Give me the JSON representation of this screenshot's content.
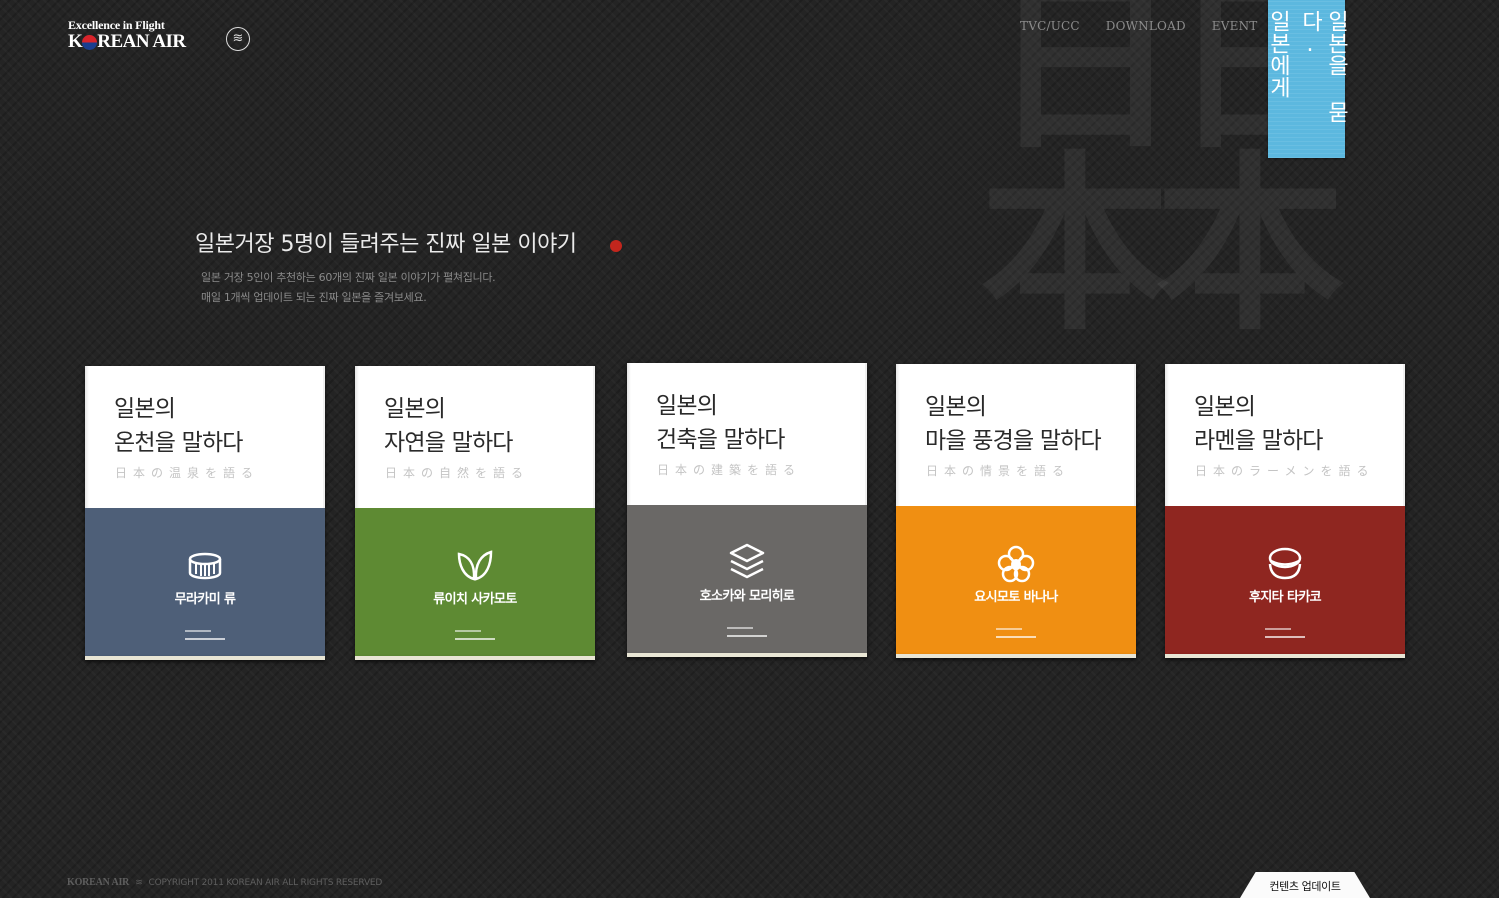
{
  "header": {
    "logo_tagline": "Excellence in Flight",
    "logo_name_part1": "K",
    "logo_name_part2": "REAN AIR",
    "nav": [
      "TVC/UCC",
      "DOWNLOAD",
      "EVENT"
    ]
  },
  "banner": {
    "col1": "일본에게",
    "col2": "일본을 묻다.",
    "color": "#5cb8df"
  },
  "watermark": {
    "chars": [
      "日",
      "日",
      "本",
      "本"
    ]
  },
  "intro": {
    "headline": "일본거장 5명이 들려주는 진짜 일본 이야기",
    "line1": "일본 거장 5인이 추천하는 60개의 진짜 일본 이야기가 펼쳐집니다.",
    "line2": "매일 1개씩 업데이트 되는 진짜 일본을 즐겨보세요."
  },
  "books": [
    {
      "title1": "일본의",
      "title2": "온천을 말하다",
      "subtitle": "日本の温泉を語る",
      "author": "무라카미 류",
      "icon": "bath-tub-icon",
      "color": "#4e5f78"
    },
    {
      "title1": "일본의",
      "title2": "자연을 말하다",
      "subtitle": "日本の自然を語る",
      "author": "류이치 사카모토",
      "icon": "leaf-icon",
      "color": "#5e8a33"
    },
    {
      "title1": "일본의",
      "title2": "건축을 말하다",
      "subtitle": "日本の建築を語る",
      "author": "호소카와 모리히로",
      "icon": "layers-icon",
      "color": "#6a6866"
    },
    {
      "title1": "일본의",
      "title2": "마을 풍경을 말하다",
      "subtitle": "日本の情景を語る",
      "author": "요시모토 바나나",
      "icon": "flower-icon",
      "color": "#f08f12"
    },
    {
      "title1": "일본의",
      "title2": "라멘을 말하다",
      "subtitle": "日本のラーメンを語る",
      "author": "후지타 타카코",
      "icon": "ramen-bowl-icon",
      "color": "#8f2620"
    }
  ],
  "footer": {
    "logo": "KOREAN AIR",
    "copyright": "COPYRIGHT 2011 KOREAN AIR ALL RIGHTS RESERVED",
    "update_tab": "컨텐츠 업데이트"
  }
}
